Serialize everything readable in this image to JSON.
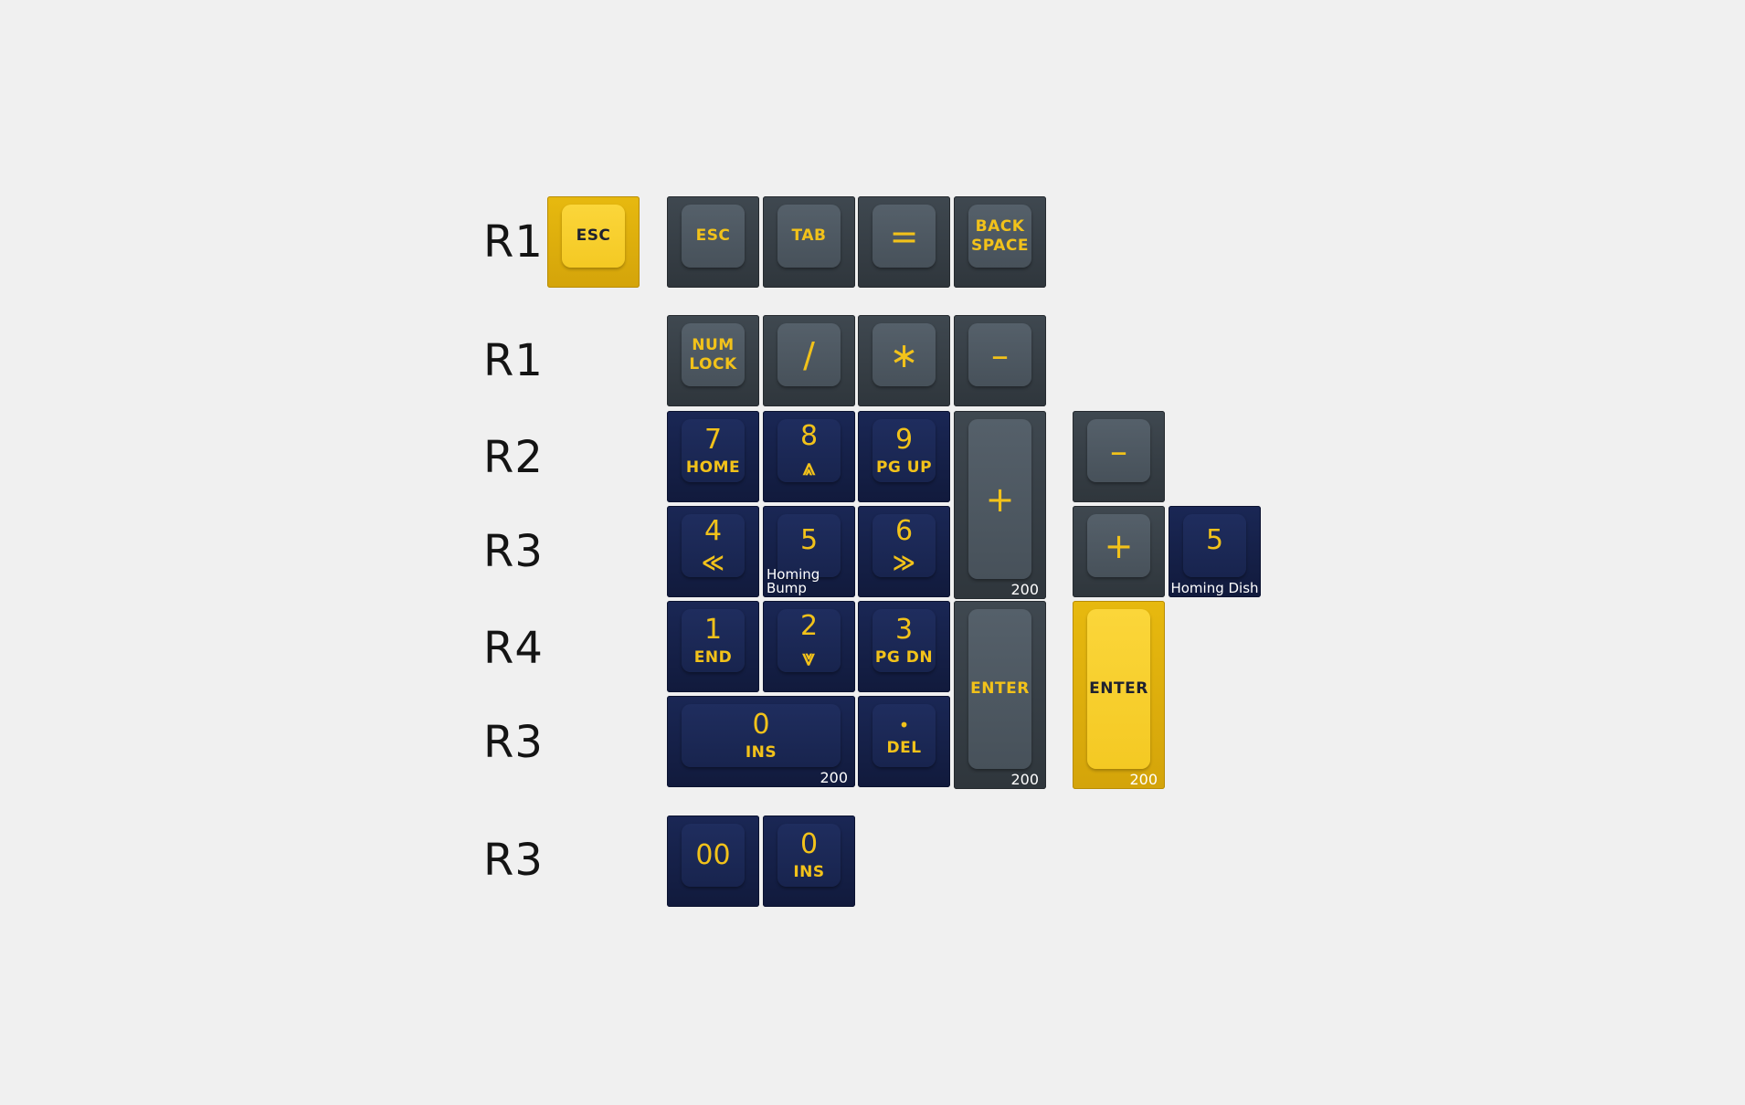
{
  "row_labels": [
    "R1",
    "R1",
    "R2",
    "R3",
    "R4",
    "R3",
    "R3"
  ],
  "colors": {
    "background": "#f0f0f0",
    "gray_keycap": "#47515a",
    "navy_keycap": "#1a2755",
    "yellow_keycap": "#f4c923",
    "legend_yellow": "#f2c21a",
    "legend_dark": "#1e2130"
  },
  "keys": {
    "esc_yellow": {
      "l1": "ESC",
      "l2": "",
      "color": "yellow"
    },
    "esc": {
      "l1": "ESC",
      "l2": "",
      "color": "gray"
    },
    "tab": {
      "l1": "TAB",
      "l2": "",
      "color": "gray"
    },
    "equals": {
      "l1": "=",
      "l2": "",
      "color": "gray"
    },
    "backspace": {
      "l1": "BACK",
      "l2": "SPACE",
      "color": "gray"
    },
    "numlock": {
      "l1": "NUM",
      "l2": "LOCK",
      "color": "gray"
    },
    "slash": {
      "l1": "/",
      "l2": "",
      "color": "gray"
    },
    "asterisk": {
      "l1": "∗",
      "l2": "",
      "color": "gray"
    },
    "minus": {
      "l1": "–",
      "l2": "",
      "color": "gray"
    },
    "num7": {
      "l1": "7",
      "l2": "HOME",
      "color": "navy"
    },
    "num8": {
      "l1": "8",
      "l2": "⩓",
      "color": "navy"
    },
    "num9": {
      "l1": "9",
      "l2": "PG UP",
      "color": "navy"
    },
    "plus_tall": {
      "l1": "+",
      "l2": "",
      "note": "200",
      "color": "gray"
    },
    "minus_extra": {
      "l1": "–",
      "l2": "",
      "color": "gray"
    },
    "num4": {
      "l1": "4",
      "l2": "≪",
      "color": "navy"
    },
    "num5": {
      "l1": "5",
      "l2": "",
      "note": "Homing Bump",
      "color": "navy"
    },
    "num6": {
      "l1": "6",
      "l2": "≫",
      "color": "navy"
    },
    "plus_extra": {
      "l1": "+",
      "l2": "",
      "color": "gray"
    },
    "num5_dish": {
      "l1": "5",
      "l2": "",
      "note": "Homing Dish",
      "color": "navy"
    },
    "num1": {
      "l1": "1",
      "l2": "END",
      "color": "navy"
    },
    "num2": {
      "l1": "2",
      "l2": "⩔",
      "color": "navy"
    },
    "num3": {
      "l1": "3",
      "l2": "PG DN",
      "color": "navy"
    },
    "enter_gray": {
      "l1": "ENTER",
      "l2": "",
      "note": "200",
      "color": "gray"
    },
    "enter_yellow": {
      "l1": "ENTER",
      "l2": "",
      "note": "200",
      "color": "yellow"
    },
    "num0_wide": {
      "l1": "0",
      "l2": "INS",
      "note": "200",
      "color": "navy"
    },
    "dot": {
      "l1": "•",
      "l2": "DEL",
      "color": "navy"
    },
    "num00": {
      "l1": "00",
      "l2": "",
      "color": "navy"
    },
    "num0": {
      "l1": "0",
      "l2": "INS",
      "color": "navy"
    }
  }
}
